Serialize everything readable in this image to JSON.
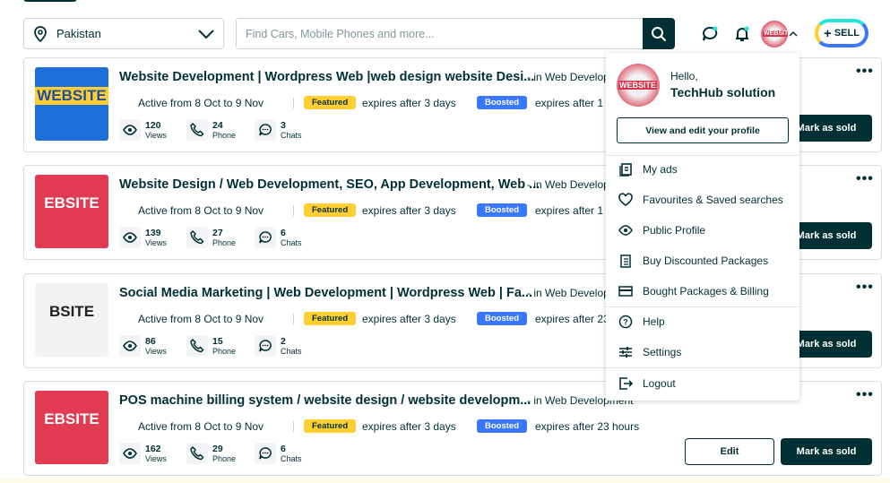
{
  "header": {
    "location": "Pakistan",
    "search_placeholder": "Find Cars, Mobile Phones and more...",
    "sell_label": "SELL"
  },
  "ads": [
    {
      "title": "Website Development | Wordpress Web |web design website Desi...",
      "category": "- in Web Development",
      "active": "Active from 8 Oct to 9 Nov",
      "featured": "Featured",
      "featured_expiry": "expires after 3 days",
      "boosted": "Boosted",
      "boosted_expiry": "expires after 1 day",
      "views": "120",
      "phone": "24",
      "chats": "3",
      "thumb_text": "WEBSITE",
      "thumb_color": "#1e6fd9"
    },
    {
      "title": "Website Design / Web Development, SEO, App Development, Web ...",
      "category": "- in Web Development",
      "active": "Active from 8 Oct to 9 Nov",
      "featured": "Featured",
      "featured_expiry": "expires after 3 days",
      "boosted": "Boosted",
      "boosted_expiry": "expires after 1 day",
      "views": "139",
      "phone": "27",
      "chats": "6",
      "thumb_text": "EBSITE",
      "thumb_color": "#e23a52"
    },
    {
      "title": "Social Media Marketing | Web Development | Wordpress Web | Fa...",
      "category": "- in Web Development",
      "active": "Active from 8 Oct to 9 Nov",
      "featured": "Featured",
      "featured_expiry": "expires after 3 days",
      "boosted": "Boosted",
      "boosted_expiry": "expires after 23 hours",
      "views": "86",
      "phone": "15",
      "chats": "2",
      "thumb_text": "BSITE",
      "thumb_color": "#f2f2f2"
    },
    {
      "title": "POS machine billing system / website design / website developm...",
      "category": "- in Web Development",
      "active": "Active from 8 Oct to 9 Nov",
      "featured": "Featured",
      "featured_expiry": "expires after 3 days",
      "boosted": "Boosted",
      "boosted_expiry": "expires after 23 hours",
      "views": "162",
      "phone": "29",
      "chats": "6",
      "thumb_text": "EBSITE",
      "thumb_color": "#e23a52"
    }
  ],
  "labels": {
    "views": "Views",
    "phone": "Phone",
    "chats": "Chats",
    "edit": "Edit",
    "mark_sold": "Mark as sold",
    "more": "•••"
  },
  "menu": {
    "hello": "Hello,",
    "user": "TechHub solution",
    "view_profile": "View and edit your profile",
    "items": [
      "My ads",
      "Favourites & Saved searches",
      "Public Profile",
      "Buy Discounted Packages",
      "Bought Packages & Billing",
      "Help",
      "Settings",
      "Logout"
    ]
  },
  "colors": {
    "primary": "#002f34",
    "featured": "#ffce32",
    "boosted": "#3a77ff"
  }
}
